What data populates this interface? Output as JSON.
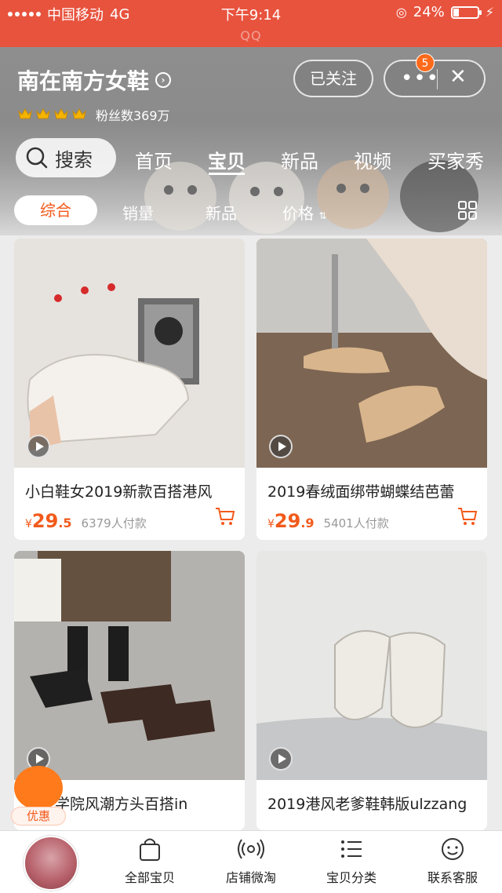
{
  "status_bar": {
    "carrier": "中国移动",
    "network": "4G",
    "time": "下午9:14",
    "battery_percent": "24%",
    "battery_level": 0.24
  },
  "app_label": "QQ",
  "shop": {
    "name": "南在南方女鞋",
    "crown_count": 4,
    "fans": "粉丝数369万",
    "follow_label": "已关注",
    "notification_count": "5",
    "more_icon": "more-dots-icon",
    "close_icon": "close-icon"
  },
  "nav": {
    "search_label": "搜索",
    "tabs": [
      {
        "label": "首页",
        "active": false
      },
      {
        "label": "宝贝",
        "active": true
      },
      {
        "label": "新品",
        "active": false
      },
      {
        "label": "视频",
        "active": false
      },
      {
        "label": "买家秀",
        "active": false
      }
    ]
  },
  "filters": {
    "items": [
      {
        "label": "综合",
        "active": true
      },
      {
        "label": "销量",
        "active": false
      },
      {
        "label": "新品",
        "active": false
      },
      {
        "label": "价格",
        "active": false
      }
    ],
    "layout_icon": "grid-view-icon"
  },
  "products": [
    {
      "title": "小白鞋女2019新款百搭港风",
      "price_yen": "¥",
      "price_int": "29",
      "price_dec": ".5",
      "sold": "6379人付款"
    },
    {
      "title": "2019春绒面绑带蝴蝶结芭蕾",
      "price_yen": "¥",
      "price_int": "29",
      "price_dec": ".9",
      "sold": "5401人付款"
    },
    {
      "title": "英伦学院风潮方头百搭in",
      "price_yen": "",
      "price_int": "",
      "price_dec": "",
      "sold": ""
    },
    {
      "title": "2019港风老爹鞋韩版ulzzang",
      "price_yen": "",
      "price_int": "",
      "price_dec": "",
      "sold": ""
    }
  ],
  "promo_label": "优惠",
  "bottom_nav": [
    {
      "label": "全部宝贝",
      "icon": "shopping-bag-icon"
    },
    {
      "label": "店铺微淘",
      "icon": "broadcast-icon"
    },
    {
      "label": "宝贝分类",
      "icon": "category-list-icon"
    },
    {
      "label": "联系客服",
      "icon": "customer-service-icon"
    }
  ],
  "colors": {
    "brand_red": "#e8533e",
    "accent_orange": "#f25a1b"
  }
}
